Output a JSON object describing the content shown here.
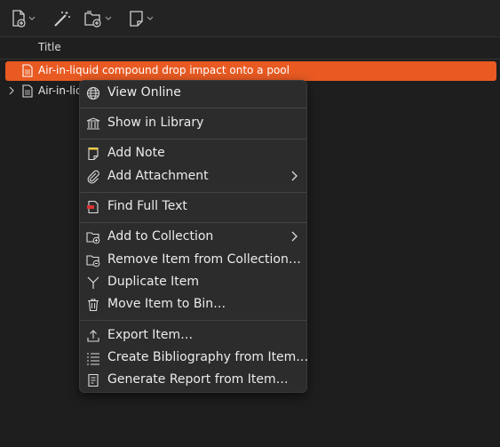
{
  "toolbar": {
    "buttons": [
      {
        "name": "new-item-icon"
      },
      {
        "name": "magic-wand-icon"
      },
      {
        "name": "new-collection-icon"
      },
      {
        "name": "new-note-icon"
      }
    ]
  },
  "columns": {
    "title": "Title"
  },
  "items": [
    {
      "title": "Air-in-liquid compound drop impact onto a pool",
      "selected": true
    },
    {
      "title": "Air-in-liqu",
      "selected": false
    }
  ],
  "context_menu": {
    "items": [
      {
        "label": "View Online",
        "icon": "globe-icon"
      },
      {
        "label": "Show in Library",
        "icon": "library-icon"
      },
      {
        "label": "Add Note",
        "icon": "note-icon"
      },
      {
        "label": "Add Attachment",
        "icon": "paperclip-icon",
        "submenu": true
      },
      {
        "label": "Find Full Text",
        "icon": "pdf-icon"
      },
      {
        "label": "Add to Collection",
        "icon": "add-collection-icon",
        "submenu": true
      },
      {
        "label": "Remove Item from Collection…",
        "icon": "remove-collection-icon"
      },
      {
        "label": "Duplicate Item",
        "icon": "duplicate-icon"
      },
      {
        "label": "Move Item to Bin…",
        "icon": "trash-icon"
      },
      {
        "label": "Export Item…",
        "icon": "export-icon"
      },
      {
        "label": "Create Bibliography from Item…",
        "icon": "bibliography-icon"
      },
      {
        "label": "Generate Report from Item…",
        "icon": "report-icon"
      }
    ]
  },
  "colors": {
    "selection": "#e85a22",
    "menu_bg": "#2c2c2c",
    "pdf_red": "#d33",
    "note_yellow": "#f3c623"
  }
}
